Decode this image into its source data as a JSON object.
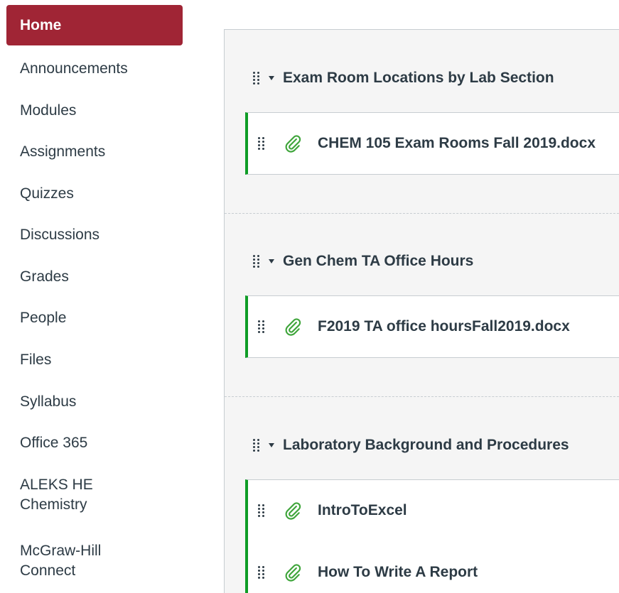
{
  "nav": {
    "items": [
      {
        "label": "Home"
      },
      {
        "label": "Announcements"
      },
      {
        "label": "Modules"
      },
      {
        "label": "Assignments"
      },
      {
        "label": "Quizzes"
      },
      {
        "label": "Discussions"
      },
      {
        "label": "Grades"
      },
      {
        "label": "People"
      },
      {
        "label": "Files"
      },
      {
        "label": "Syllabus"
      },
      {
        "label": "Office 365"
      },
      {
        "label": "ALEKS HE Chemistry"
      },
      {
        "label": "McGraw-Hill Connect"
      }
    ],
    "active": "Home"
  },
  "modules": [
    {
      "title": "Exam Room Locations by Lab Section",
      "items": [
        {
          "title": "CHEM 105 Exam Rooms Fall 2019.docx",
          "icon": "paperclip-icon"
        }
      ]
    },
    {
      "title": "Gen Chem TA Office Hours",
      "items": [
        {
          "title": "F2019 TA office hoursFall2019.docx",
          "icon": "paperclip-icon"
        }
      ]
    },
    {
      "title": "Laboratory Background and Procedures",
      "items": [
        {
          "title": "IntroToExcel",
          "icon": "paperclip-icon"
        },
        {
          "title": "How To Write A Report",
          "icon": "paperclip-icon"
        }
      ]
    }
  ],
  "colors": {
    "active_nav": "#a02535",
    "item_border": "#0f9d26",
    "clip": "#3fa53b"
  }
}
